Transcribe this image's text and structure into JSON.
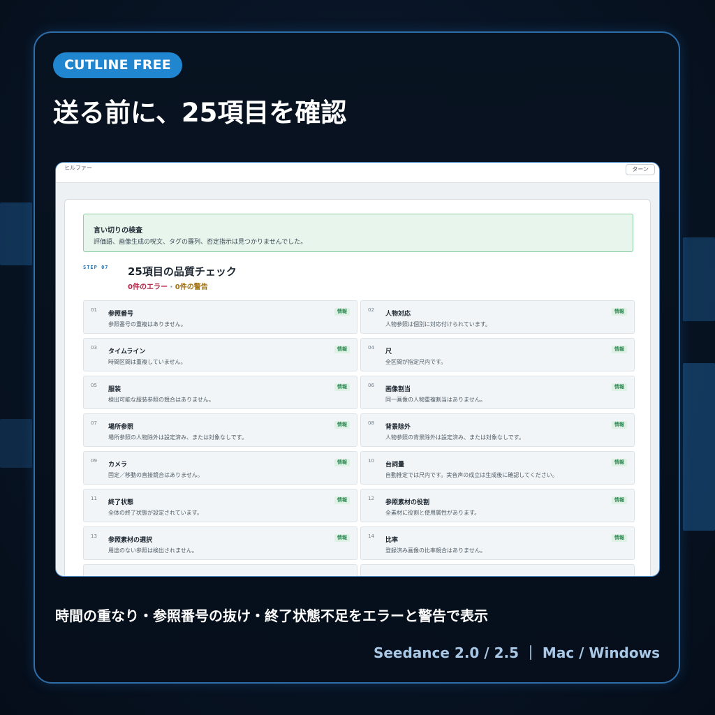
{
  "badge": "CUTLINE FREE",
  "headline": "送る前に、25項目を確認",
  "screenshot": {
    "topbar_label": "ヒルファー",
    "topbar_button": "ターン",
    "notice": {
      "title": "言い切りの検査",
      "body": "評価語、画像生成の呪文、タグの羅列、否定指示は見つかりませんでした。"
    },
    "step_label": "STEP 07",
    "section_title": "25項目の品質チェック",
    "counts": {
      "errors": "0件のエラー",
      "separator": "·",
      "warnings": "0件の警告"
    },
    "items": [
      {
        "num": "01",
        "title": "参照番号",
        "desc": "参照番号の重複はありません。",
        "tag": "情報"
      },
      {
        "num": "02",
        "title": "人物対応",
        "desc": "人物参照は個別に対応付けられています。",
        "tag": "情報"
      },
      {
        "num": "03",
        "title": "タイムライン",
        "desc": "時間区間は重複していません。",
        "tag": "情報"
      },
      {
        "num": "04",
        "title": "尺",
        "desc": "全区間が指定尺内です。",
        "tag": "情報"
      },
      {
        "num": "05",
        "title": "服装",
        "desc": "検出可能な服装参照の競合はありません。",
        "tag": "情報"
      },
      {
        "num": "06",
        "title": "画像割当",
        "desc": "同一画像の人物重複割当はありません。",
        "tag": "情報"
      },
      {
        "num": "07",
        "title": "場所参照",
        "desc": "場所参照の人物除外は設定済み、または対象なしです。",
        "tag": "情報"
      },
      {
        "num": "08",
        "title": "背景除外",
        "desc": "人物参照の背景除外は設定済み、または対象なしです。",
        "tag": "情報"
      },
      {
        "num": "09",
        "title": "カメラ",
        "desc": "固定／移動の直接競合はありません。",
        "tag": "情報"
      },
      {
        "num": "10",
        "title": "台詞量",
        "desc": "自動推定では尺内です。実音声の成立は生成後に確認してください。",
        "tag": "情報"
      },
      {
        "num": "11",
        "title": "終了状態",
        "desc": "全体の終了状態が設定されています。",
        "tag": "情報"
      },
      {
        "num": "12",
        "title": "参照素材の役割",
        "desc": "全素材に役割と使用属性があります。",
        "tag": "情報"
      },
      {
        "num": "13",
        "title": "参照素材の選択",
        "desc": "用途のない参照は検出されません。",
        "tag": "情報"
      },
      {
        "num": "14",
        "title": "比率",
        "desc": "登録済み画像の比率競合はありません。",
        "tag": "情報"
      }
    ]
  },
  "caption": "時間の重なり・参照番号の抜け・終了状態不足をエラーと警告で表示",
  "footer": "Seedance 2.0 / 2.5 ｜ Mac / Windows"
}
